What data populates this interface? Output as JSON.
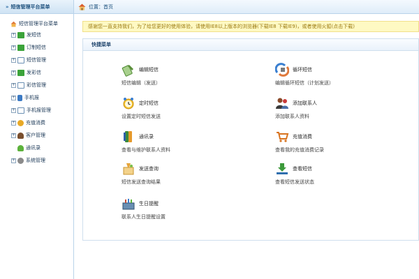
{
  "sidebar": {
    "header": "短信管理平台菜单",
    "root": "短信管理平台菜单",
    "items": [
      {
        "label": "发短信",
        "icon": "envelope-icon",
        "expander": "+"
      },
      {
        "label": "订制短信",
        "icon": "envelope-icon",
        "expander": "+"
      },
      {
        "label": "短信管理",
        "icon": "document-icon",
        "expander": "+"
      },
      {
        "label": "发彩信",
        "icon": "envelope-icon",
        "expander": "+"
      },
      {
        "label": "彩信管理",
        "icon": "document-icon",
        "expander": "+"
      },
      {
        "label": "手机报",
        "icon": "phone-icon",
        "expander": "+"
      },
      {
        "label": "手机报管理",
        "icon": "document-icon",
        "expander": "+"
      },
      {
        "label": "充值消费",
        "icon": "coins-icon",
        "expander": "+"
      },
      {
        "label": "客户管理",
        "icon": "users-icon",
        "expander": "+"
      },
      {
        "label": "通讯录",
        "icon": "contact-icon",
        "expander": ""
      },
      {
        "label": "系统管理",
        "icon": "gear-icon",
        "expander": "+"
      }
    ]
  },
  "topbar": {
    "breadcrumb": "位置：首页"
  },
  "notice": "感谢您一直支持我们，为了给您更好的使用体验，请使用IE8以上版本的浏览器(下载IE8 下载IE9)，或者使用火狐(点击下载)",
  "panel": {
    "title": "快捷菜单",
    "actions": [
      {
        "label": "编辑短信",
        "desc": "短信编辑（发送）",
        "icon": "edit-sms-icon"
      },
      {
        "label": "循环短信",
        "desc": "编辑循环短信（计划发送）",
        "icon": "loop-sms-icon"
      },
      {
        "label": "定时短信",
        "desc": "设置定时短信发送",
        "icon": "alarm-clock-icon"
      },
      {
        "label": "添加联系人",
        "desc": "添加联系人资料",
        "icon": "add-contact-icon"
      },
      {
        "label": "通讯录",
        "desc": "查看与维护联系人资料",
        "icon": "address-book-icon"
      },
      {
        "label": "充值消费",
        "desc": "查看我的充值消费记录",
        "icon": "shopping-cart-icon"
      },
      {
        "label": "发送查询",
        "desc": "短信发送查询结果",
        "icon": "send-query-icon"
      },
      {
        "label": "查看短信",
        "desc": "查看短信发送状态",
        "icon": "download-icon"
      },
      {
        "label": "生日提醒",
        "desc": "联系人生日提醒设置",
        "icon": "birthday-icon"
      }
    ]
  },
  "colors": {
    "sidebar_border": "#b9d3ea",
    "notice_bg": "#fef9c3",
    "notice_text": "#9b7a10",
    "title_blue": "#22476e"
  }
}
